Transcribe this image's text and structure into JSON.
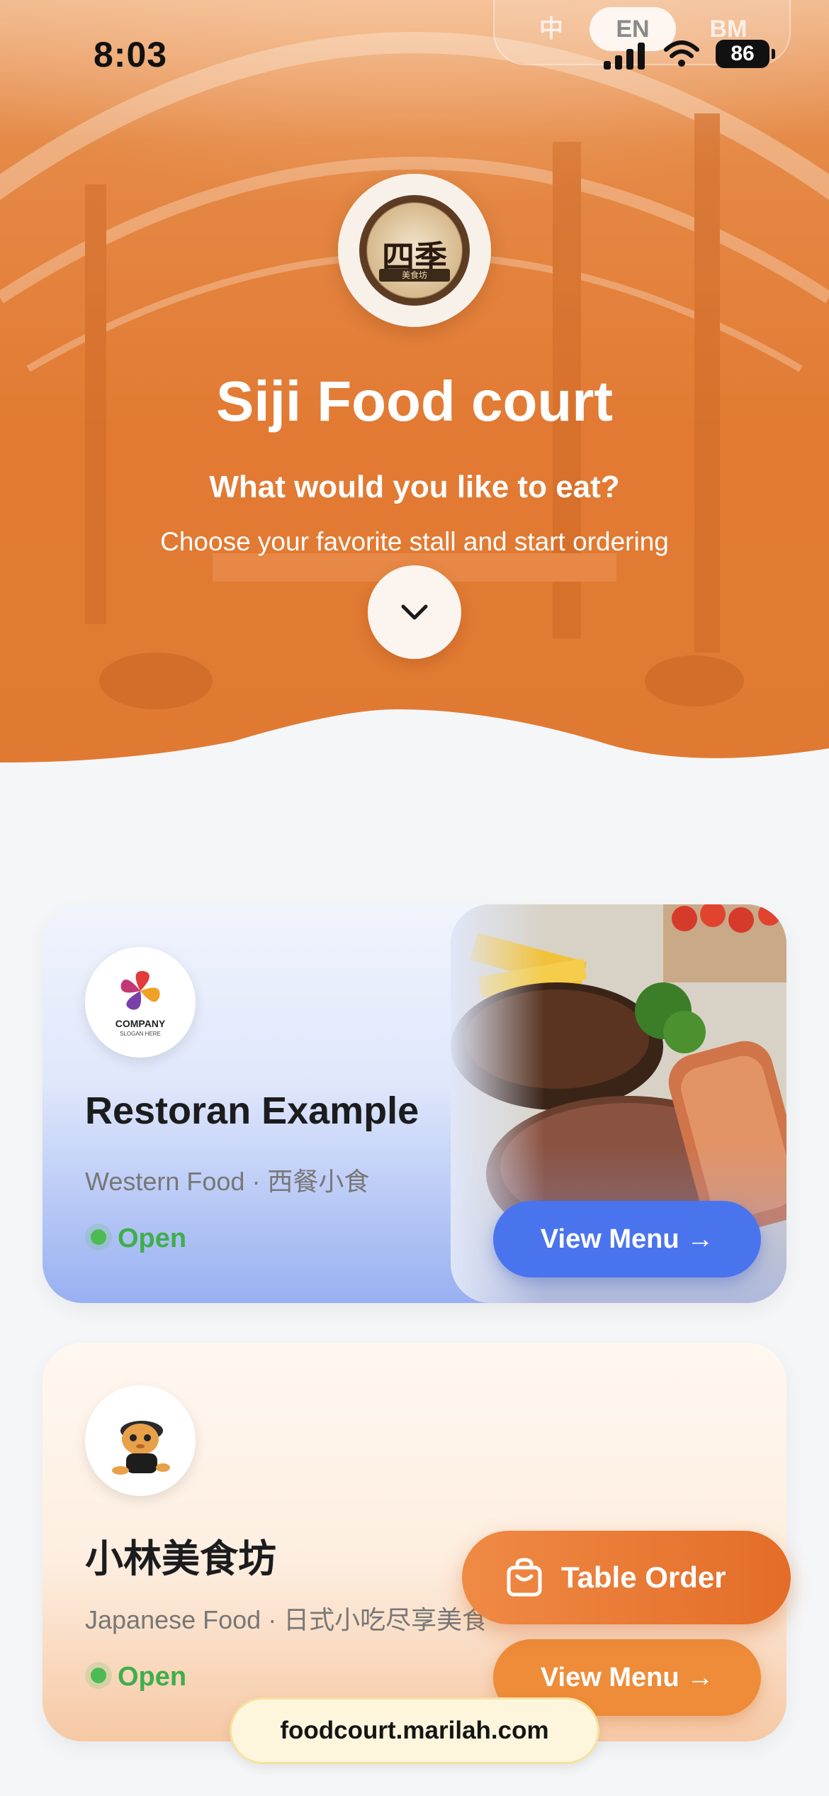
{
  "status_bar": {
    "time": "8:03",
    "battery": "86"
  },
  "language": {
    "options": [
      "中",
      "EN",
      "BM"
    ],
    "selected": "EN"
  },
  "hero": {
    "logo_text": "四季",
    "logo_subtext": "美食坊",
    "title": "Siji Food court",
    "question": "What would you like to eat?",
    "subtitle": "Choose your favorite stall and start ordering"
  },
  "stalls": [
    {
      "name": "Restoran Example",
      "subtitle": "Western Food · 西餐小食",
      "status": "Open",
      "button": "View Menu →",
      "logo_company": "COMPANY",
      "logo_slogan": "SLOGAN HERE"
    },
    {
      "name": "小林美食坊",
      "subtitle": "Japanese Food · 日式小吃尽享美食",
      "status": "Open",
      "button": "View Menu →"
    }
  ],
  "floating": {
    "table_order": "Table Order"
  },
  "footer": {
    "url": "foodcourt.marilah.com"
  },
  "colors": {
    "hero_orange": "#e27a33",
    "blue_button": "#4a74ee",
    "orange_button": "#ee8c3a",
    "open_green": "#3fae4b"
  }
}
